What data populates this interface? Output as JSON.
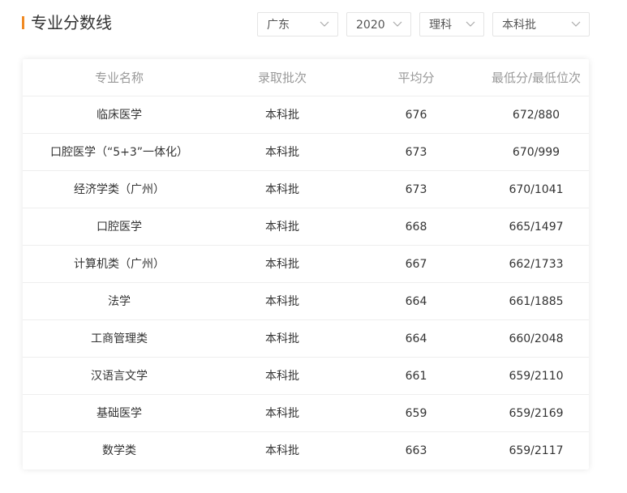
{
  "header": {
    "title": "专业分数线",
    "accent_color": "#f08a24",
    "filters": {
      "province": "广东",
      "year": "2020",
      "subject": "理科",
      "batch": "本科批"
    },
    "chevron_icon": "chevron-down-icon"
  },
  "table": {
    "columns": [
      "专业名称",
      "录取批次",
      "平均分",
      "最低分/最低位次"
    ],
    "rows": [
      {
        "major": "临床医学",
        "batch": "本科批",
        "avg": "676",
        "min": "672/880"
      },
      {
        "major": "口腔医学（“5+3”一体化）",
        "batch": "本科批",
        "avg": "673",
        "min": "670/999"
      },
      {
        "major": "经济学类（广州）",
        "batch": "本科批",
        "avg": "673",
        "min": "670/1041"
      },
      {
        "major": "口腔医学",
        "batch": "本科批",
        "avg": "668",
        "min": "665/1497"
      },
      {
        "major": "计算机类（广州）",
        "batch": "本科批",
        "avg": "667",
        "min": "662/1733"
      },
      {
        "major": "法学",
        "batch": "本科批",
        "avg": "664",
        "min": "661/1885"
      },
      {
        "major": "工商管理类",
        "batch": "本科批",
        "avg": "664",
        "min": "660/2048"
      },
      {
        "major": "汉语言文学",
        "batch": "本科批",
        "avg": "661",
        "min": "659/2110"
      },
      {
        "major": "基础医学",
        "batch": "本科批",
        "avg": "659",
        "min": "659/2169"
      },
      {
        "major": "数学类",
        "batch": "本科批",
        "avg": "663",
        "min": "659/2117"
      }
    ]
  }
}
